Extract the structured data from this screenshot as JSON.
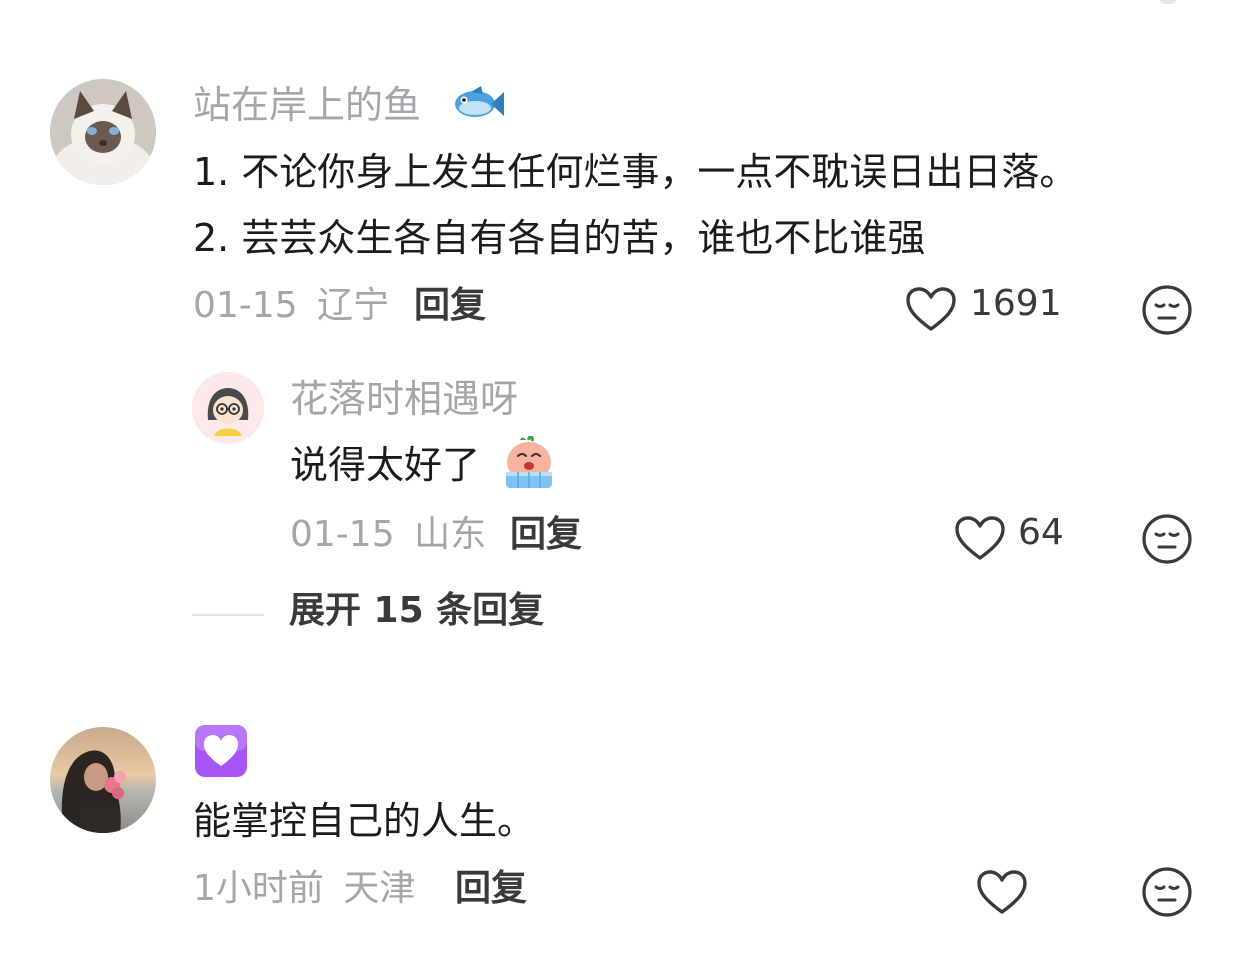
{
  "comments": [
    {
      "username": "站在岸上的鱼",
      "username_emoji": "fish-emoji",
      "lines": [
        "1. 不论你身上发生任何烂事，一点不耽误日出日落。",
        "2. 芸芸众生各自有各自的苦，谁也不比谁强"
      ],
      "date": "01-15",
      "location": "辽宁",
      "reply_label": "回复",
      "like_count": "1691",
      "avatar": "cat-avatar",
      "replies": [
        {
          "username": "花落时相遇呀",
          "text": "说得太好了",
          "text_emoji": "crying-emoji",
          "date": "01-15",
          "location": "山东",
          "reply_label": "回复",
          "like_count": "64",
          "avatar": "cartoon-girl-avatar"
        }
      ],
      "expand_label": "展开 15 条回复"
    },
    {
      "username_emoji": "purple-heart-emoji",
      "text": "能掌控自己的人生。",
      "time": "1小时前",
      "location": "天津",
      "reply_label": "回复",
      "like_count": "",
      "avatar": "sunset-person-avatar"
    }
  ],
  "colors": {
    "username": "#a5a5aa",
    "body_text": "#1c1c1e",
    "meta": "#a5a5aa",
    "action": "#3a3a3c",
    "heart_purple": "#a855f7"
  }
}
